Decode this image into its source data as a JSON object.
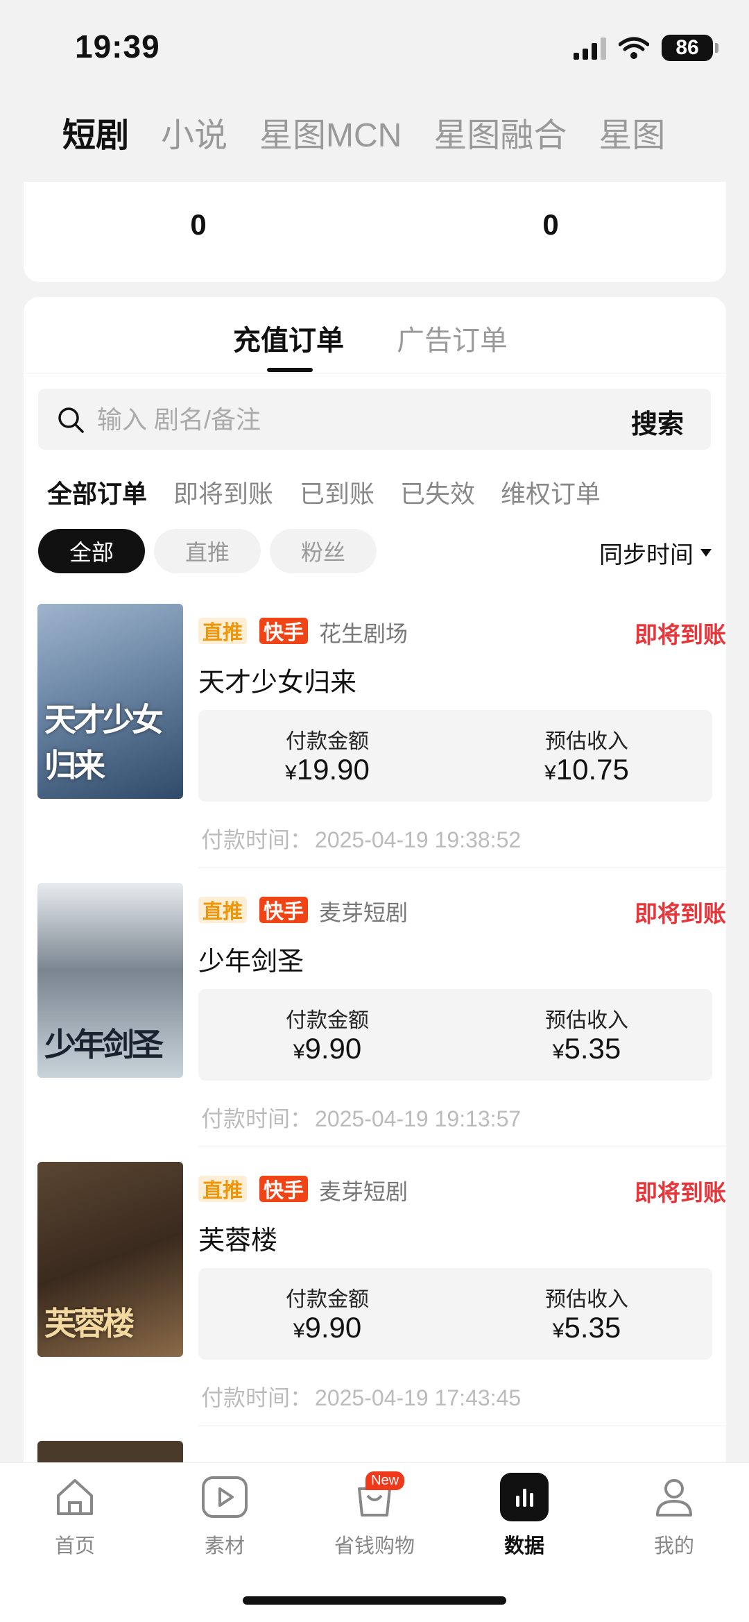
{
  "status_bar": {
    "time": "19:39",
    "battery": "86"
  },
  "top_tabs": [
    "短剧",
    "小说",
    "星图MCN",
    "星图融合",
    "星图"
  ],
  "summary": {
    "left_value": "0",
    "right_value": "0"
  },
  "order_tabs": [
    "充值订单",
    "广告订单"
  ],
  "search": {
    "placeholder": "输入 剧名/备注",
    "button": "搜索"
  },
  "filter_tabs": [
    "全部订单",
    "即将到账",
    "已到账",
    "已失效",
    "维权订单"
  ],
  "chips": [
    "全部",
    "直推",
    "粉丝"
  ],
  "sort_label": "同步时间",
  "labels": {
    "amount": "付款金额",
    "income": "预估收入",
    "pay_time": "付款时间："
  },
  "orders": [
    {
      "tag_type": "直推",
      "tag_platform": "快手",
      "source": "花生剧场",
      "status": "即将到账",
      "title": "天才少女归来",
      "amount": "19.90",
      "income": "10.75",
      "pay_time": "2025-04-19 19:38:52",
      "poster_text": "天才少女归来"
    },
    {
      "tag_type": "直推",
      "tag_platform": "快手",
      "source": "麦芽短剧",
      "status": "即将到账",
      "title": "少年剑圣",
      "amount": "9.90",
      "income": "5.35",
      "pay_time": "2025-04-19 19:13:57",
      "poster_text": "少年剑圣"
    },
    {
      "tag_type": "直推",
      "tag_platform": "快手",
      "source": "麦芽短剧",
      "status": "即将到账",
      "title": "芙蓉楼",
      "amount": "9.90",
      "income": "5.35",
      "pay_time": "2025-04-19 17:43:45",
      "poster_text": "芙蓉楼"
    }
  ],
  "currency": "¥",
  "bottom_nav": [
    {
      "label": "首页",
      "icon": "home-icon"
    },
    {
      "label": "素材",
      "icon": "play-icon"
    },
    {
      "label": "省钱购物",
      "icon": "shopping-bag-icon",
      "badge": "New"
    },
    {
      "label": "数据",
      "icon": "bar-chart-icon",
      "active": true
    },
    {
      "label": "我的",
      "icon": "user-icon"
    }
  ],
  "colors": {
    "accent_red": "#e8353a",
    "kuaishou": "#f04416",
    "direct_tag_bg": "#fdeed5",
    "direct_tag_fg": "#f0960a"
  }
}
